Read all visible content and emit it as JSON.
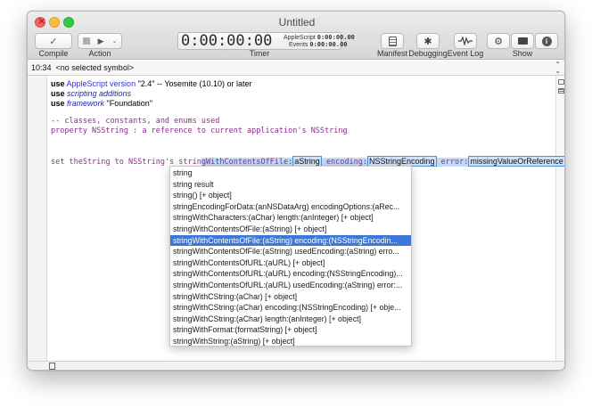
{
  "window": {
    "title": "Untitled"
  },
  "toolbar": {
    "compile_label": "Compile",
    "action_label": "Action",
    "timer_label": "Timer",
    "manifest_label": "Manifest",
    "debugging_label": "Debugging",
    "eventlog_label": "Event Log",
    "show_label": "Show"
  },
  "timer": {
    "main": "0:00:00:00",
    "applescript_label": "AppleScript",
    "applescript_value": "0:00:00.00",
    "events_label": "Events",
    "events_value": "0:00:00.00"
  },
  "symbolbar": {
    "text": "10:34  <no selected symbol>"
  },
  "code": {
    "l1_use": "use",
    "l1_kw": "AppleScript version",
    "l1_str": "\"2.4\"",
    "l1_comment": " -- Yosemite (10.10) or later",
    "l2_use": "use",
    "l2_val": "scripting additions",
    "l3_use": "use",
    "l3_kw": "framework",
    "l3_str": " \"Foundation\"",
    "l4": "-- classes, constants, and enums used",
    "l5": "property NSString : a reference to current application's NSString",
    "l6_prefix": "set theString to NSString's strin",
    "l6_hl1": "gWithContentsOfFile:",
    "l6_box1": "aString",
    "l6_hl2": " encoding:",
    "l6_box2": "NSStringEncoding",
    "l6_hl3": " error:",
    "l6_box3": "missingValueOrReference"
  },
  "completions": [
    "string",
    "string result",
    "string() [+ object]",
    "stringEncodingForData:(anNSDataArg) encodingOptions:(aRec...",
    "stringWithCharacters:(aChar) length:(anInteger) [+ object]",
    "stringWithContentsOfFile:(aString) [+ object]",
    "stringWithContentsOfFile:(aString) encoding:(NSStringEncodin...",
    "stringWithContentsOfFile:(aString) usedEncoding:(aString) erro...",
    "stringWithContentsOfURL:(aURL) [+ object]",
    "stringWithContentsOfURL:(aURL) encoding:(NSStringEncoding)...",
    "stringWithContentsOfURL:(aURL) usedEncoding:(aString) error:...",
    "stringWithCString:(aChar) [+ object]",
    "stringWithCString:(aChar) encoding:(NSStringEncoding) [+ obje...",
    "stringWithCString:(aChar) length:(anInteger) [+ object]",
    "stringWithFormat:(formatString) [+ object]",
    "stringWithString:(aString) [+ object]"
  ],
  "selected_index": 6,
  "colors": {
    "selection": "#3b78d8",
    "keyword_blue": "#3333cc",
    "purple": "#8a2e8a",
    "highlight": "#c3dbf7"
  }
}
